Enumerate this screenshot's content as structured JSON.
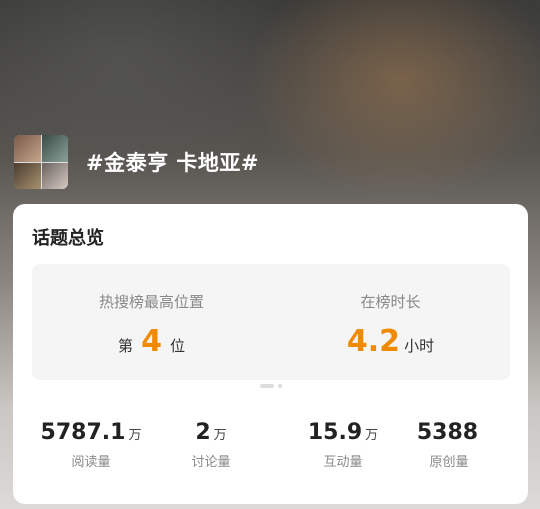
{
  "topic": {
    "title": "#金泰亨 卡地亚#"
  },
  "card": {
    "title": "话题总览",
    "hot_rank": {
      "label": "热搜榜最高位置",
      "prefix": "第",
      "value": "4",
      "suffix": "位"
    },
    "duration": {
      "label": "在榜时长",
      "value": "4.2",
      "unit": "小时"
    },
    "pager": {
      "pages": 2,
      "active_page": 1
    },
    "stats": [
      {
        "value": "5787.1",
        "unit": "万",
        "label": "阅读量"
      },
      {
        "value": "2",
        "unit": "万",
        "label": "讨论量"
      },
      {
        "value": "15.9",
        "unit": "万",
        "label": "互动量"
      },
      {
        "value": "5388",
        "unit": "",
        "label": "原创量"
      }
    ]
  },
  "colors": {
    "accent": "#f08a00",
    "card_bg": "#ffffff",
    "box_bg": "#f5f5f5"
  }
}
